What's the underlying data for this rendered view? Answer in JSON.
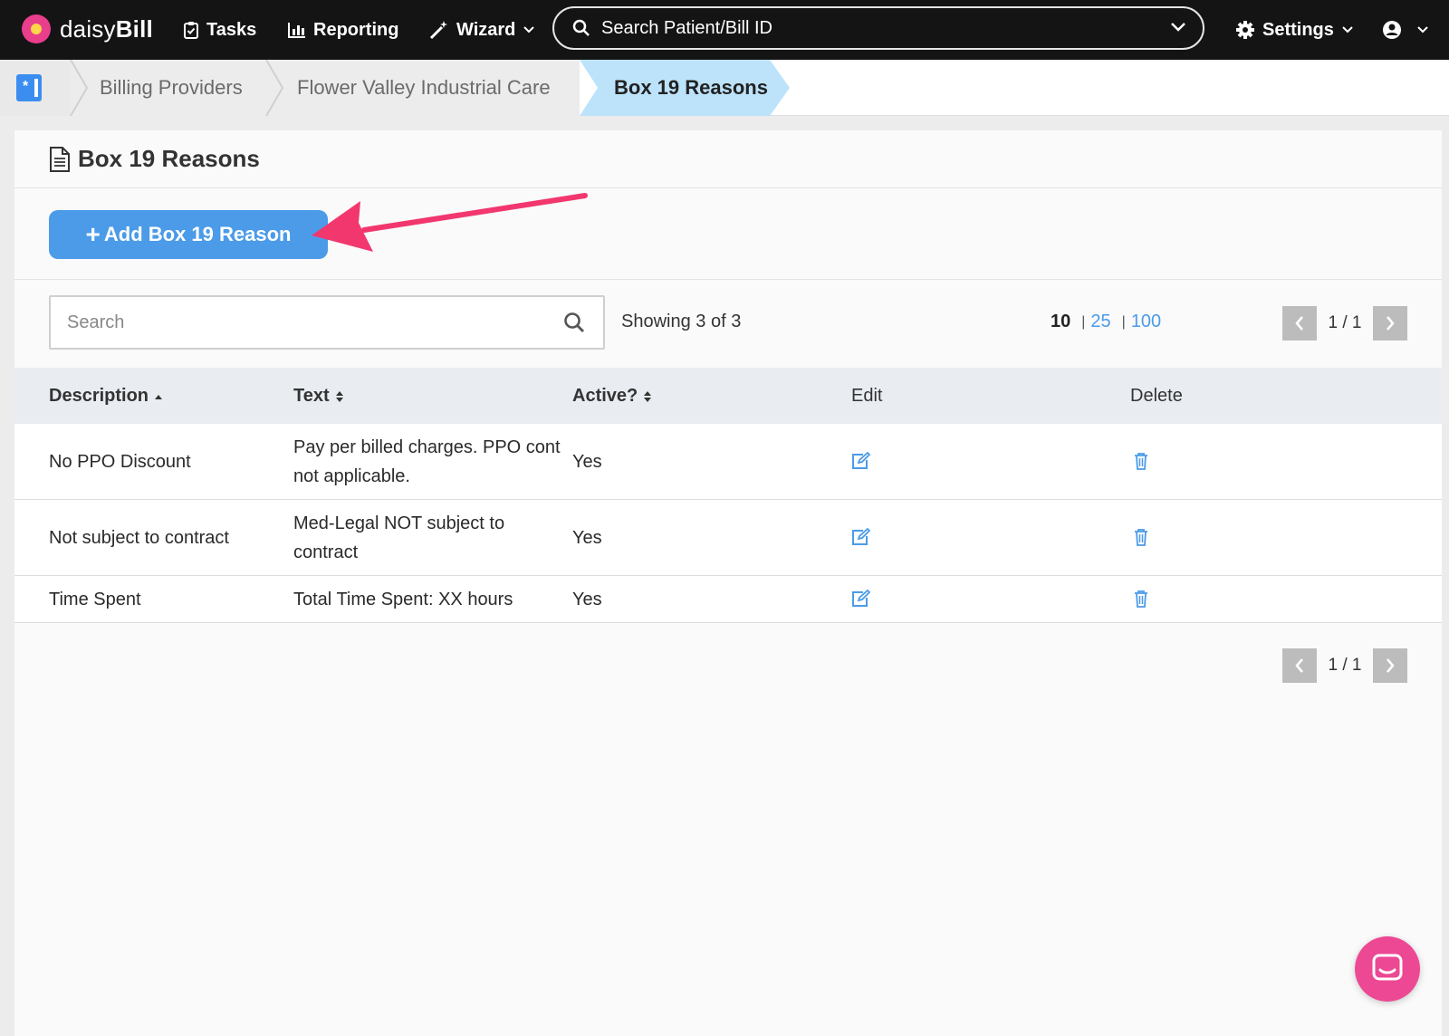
{
  "app": {
    "brand_light": "daisy",
    "brand_bold": "Bill"
  },
  "nav": {
    "tasks": "Tasks",
    "reporting": "Reporting",
    "wizard": "Wizard",
    "search_placeholder": "Search Patient/Bill ID",
    "settings": "Settings"
  },
  "breadcrumb": {
    "items": [
      "Billing Providers",
      "Flower Valley Industrial Care",
      "Box 19 Reasons"
    ]
  },
  "page": {
    "title": "Box 19 Reasons",
    "add_button": "Add Box 19 Reason",
    "search_placeholder": "Search",
    "showing": "Showing 3 of 3",
    "per_page": {
      "current": "10",
      "options": [
        "25",
        "100"
      ]
    },
    "pager": "1 / 1"
  },
  "table": {
    "headers": {
      "description": "Description",
      "text": "Text",
      "active": "Active?",
      "edit": "Edit",
      "delete": "Delete"
    },
    "rows": [
      {
        "description": "No PPO Discount",
        "text": "Pay per billed charges. PPO cont not applicable.",
        "active": "Yes"
      },
      {
        "description": "Not subject to contract",
        "text": "Med-Legal NOT subject to contract",
        "active": "Yes"
      },
      {
        "description": "Time Spent",
        "text": "Total Time Spent: XX hours",
        "active": "Yes"
      }
    ]
  },
  "colors": {
    "accent": "#4b9be8",
    "brand_pink": "#ec4893",
    "arrow": "#f2376f",
    "active_crumb": "#bde3fb"
  },
  "icons": [
    "tasks-icon",
    "reporting-icon",
    "wizard-icon",
    "search-icon",
    "chevron-down-icon",
    "gear-icon",
    "user-icon",
    "document-icon",
    "edit-icon",
    "trash-icon",
    "chevron-left-icon",
    "chevron-right-icon",
    "chat-icon"
  ]
}
